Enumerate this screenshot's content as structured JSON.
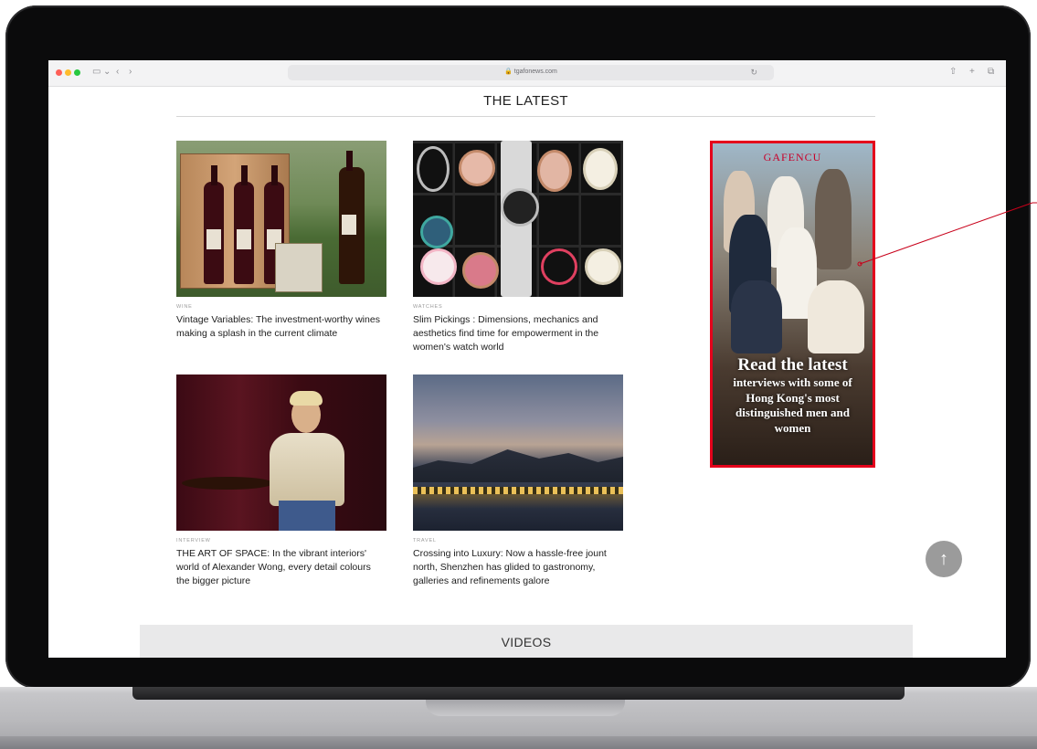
{
  "browser": {
    "address": "🔒 tgafonews.com"
  },
  "page": {
    "section_title": "THE LATEST",
    "videos_title": "VIDEOS",
    "articles": [
      {
        "category": "WINE",
        "headline": "Vintage Variables: The investment-worthy wines making a splash in the current climate"
      },
      {
        "category": "WATCHES",
        "headline": "Slim Pickings : Dimensions, mechanics and aesthetics find time for empowerment in the women's watch world"
      },
      {
        "category": "INTERVIEW",
        "headline": "THE ART OF SPACE: In the vibrant interiors' world of Alexander Wong, every detail colours the bigger picture"
      },
      {
        "category": "TRAVEL",
        "headline": "Crossing into Luxury: Now a hassle-free jount north, Shenzhen has glided to gastronomy, galleries and refinements galore"
      }
    ],
    "ad": {
      "logo": "GAFENCU",
      "line1": "Read the latest",
      "line2": "interviews with some of Hong Kong's most distinguished men and women",
      "border_color": "#e4001b"
    },
    "back_to_top": "↑"
  }
}
